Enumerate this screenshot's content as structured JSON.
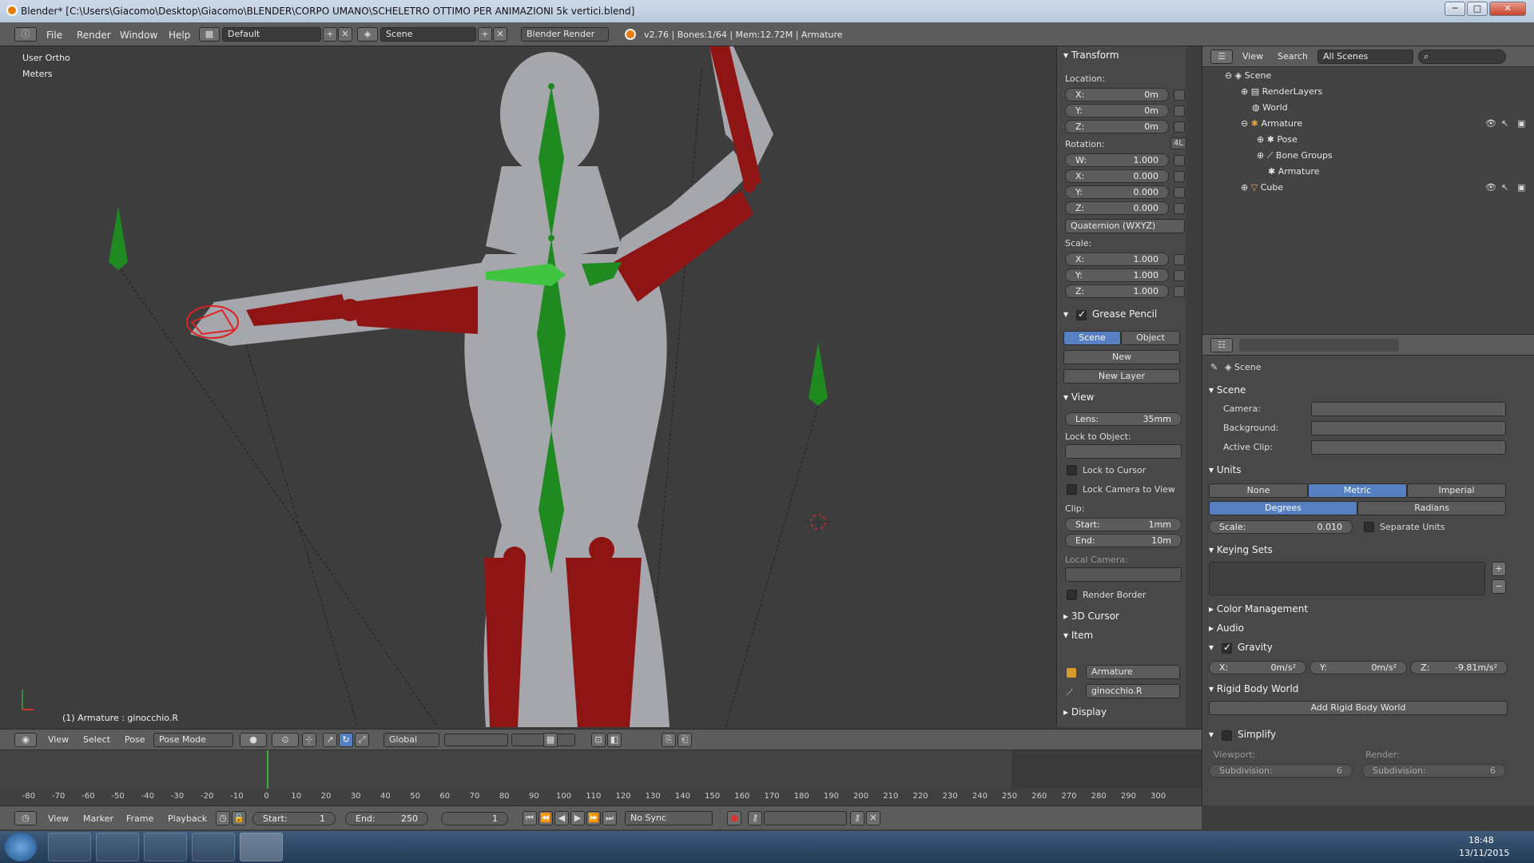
{
  "window": {
    "title": "Blender* [C:\\Users\\Giacomo\\Desktop\\Giacomo\\BLENDER\\CORPO UMANO\\SCHELETRO OTTIMO PER ANIMAZIONI 5k vertici.blend]",
    "minimize": "─",
    "maximize": "□",
    "close": "✕"
  },
  "info_header": {
    "menus": [
      "File",
      "Render",
      "Window",
      "Help"
    ],
    "layout": "Default",
    "scene": "Scene",
    "engine": "Blender Render",
    "stats": "v2.76 | Bones:1/64 | Mem:12.72M | Armature"
  },
  "viewport": {
    "view_name": "User Ortho",
    "units": "Meters",
    "active": "(1) Armature : ginocchio.R"
  },
  "npanel": {
    "transform": {
      "title": "Transform",
      "location_label": "Location:",
      "location": [
        {
          "l": "X:",
          "v": "0m"
        },
        {
          "l": "Y:",
          "v": "0m"
        },
        {
          "l": "Z:",
          "v": "0m"
        }
      ],
      "rotation_label": "Rotation:",
      "rotation_lock": "4L",
      "rotation": [
        {
          "l": "W:",
          "v": "1.000"
        },
        {
          "l": "X:",
          "v": "0.000"
        },
        {
          "l": "Y:",
          "v": "0.000"
        },
        {
          "l": "Z:",
          "v": "0.000"
        }
      ],
      "rotation_mode": "Quaternion (WXYZ)",
      "scale_label": "Scale:",
      "scale": [
        {
          "l": "X:",
          "v": "1.000"
        },
        {
          "l": "Y:",
          "v": "1.000"
        },
        {
          "l": "Z:",
          "v": "1.000"
        }
      ]
    },
    "grease_pencil": {
      "title": "Grease Pencil",
      "tab_scene": "Scene",
      "tab_object": "Object",
      "new": "New",
      "new_layer": "New Layer"
    },
    "view": {
      "title": "View",
      "lens_label": "Lens:",
      "lens": "35mm",
      "lock_to_object": "Lock to Object:",
      "lock_to_cursor": "Lock to Cursor",
      "lock_camera": "Lock Camera to View",
      "clip_label": "Clip:",
      "clip_start_label": "Start:",
      "clip_start": "1mm",
      "clip_end_label": "End:",
      "clip_end": "10m",
      "local_camera": "Local Camera:",
      "render_border": "Render Border"
    },
    "cursor_title": "3D Cursor",
    "item": {
      "title": "Item",
      "object": "Armature",
      "bone": "ginocchio.R"
    },
    "display_title": "Display"
  },
  "outliner": {
    "menus": [
      "View",
      "Search"
    ],
    "filter": "All Scenes",
    "items": [
      {
        "label": "Scene",
        "indent": 0
      },
      {
        "label": "RenderLayers",
        "indent": 1
      },
      {
        "label": "World",
        "indent": 1
      },
      {
        "label": "Armature",
        "indent": 1
      },
      {
        "label": "Pose",
        "indent": 2
      },
      {
        "label": "Bone Groups",
        "indent": 2
      },
      {
        "label": "Armature",
        "indent": 2
      },
      {
        "label": "Cube",
        "indent": 2
      }
    ]
  },
  "properties": {
    "context": "Scene",
    "scene_panel": {
      "title": "Scene",
      "camera": "Camera:",
      "background": "Background:",
      "active_clip": "Active Clip:"
    },
    "units": {
      "title": "Units",
      "systems": [
        "None",
        "Metric",
        "Imperial"
      ],
      "active_system": "Metric",
      "rotation": [
        "Degrees",
        "Radians"
      ],
      "active_rotation": "Degrees",
      "scale_label": "Scale:",
      "scale": "0.010",
      "separate_units": "Separate Units"
    },
    "keying_sets_title": "Keying Sets",
    "color_management_title": "Color Management",
    "audio_title": "Audio",
    "gravity": {
      "title": "Gravity",
      "x_label": "X:",
      "x": "0m/s²",
      "y_label": "Y:",
      "y": "0m/s²",
      "z_label": "Z:",
      "z": "-9.81m/s²"
    },
    "rigid_body_title": "Rigid Body World",
    "add_rigid_body": "Add Rigid Body World",
    "simplify": {
      "title": "Simplify",
      "viewport": "Viewport:",
      "render": "Render:",
      "subdiv_label": "Subdivision:",
      "subdiv_viewport": "6",
      "subdiv_render": "6"
    }
  },
  "viewport_header": {
    "menus": [
      "View",
      "Select",
      "Pose"
    ],
    "mode": "Pose Mode",
    "orientation": "Global"
  },
  "timeline": {
    "ticks": [
      "-80",
      "-70",
      "-60",
      "-50",
      "-40",
      "-30",
      "-20",
      "-10",
      "0",
      "10",
      "20",
      "30",
      "40",
      "50",
      "60",
      "70",
      "80",
      "90",
      "100",
      "110",
      "120",
      "130",
      "140",
      "150",
      "160",
      "170",
      "180",
      "190",
      "200",
      "210",
      "220",
      "230",
      "240",
      "250",
      "260",
      "270",
      "280",
      "290",
      "300"
    ],
    "current_frame_marker": 0,
    "menus": [
      "View",
      "Marker",
      "Frame",
      "Playback"
    ],
    "start_label": "Start:",
    "start": "1",
    "end_label": "End:",
    "end": "250",
    "current": "1",
    "sync": "No Sync"
  },
  "taskbar": {
    "time": "18:48",
    "date": "13/11/2015"
  },
  "colors": {
    "bone_green": "#1f8a1f",
    "bone_red": "#8a1111",
    "mesh": "#a6a6ad",
    "accent_blue": "#5680c2"
  }
}
